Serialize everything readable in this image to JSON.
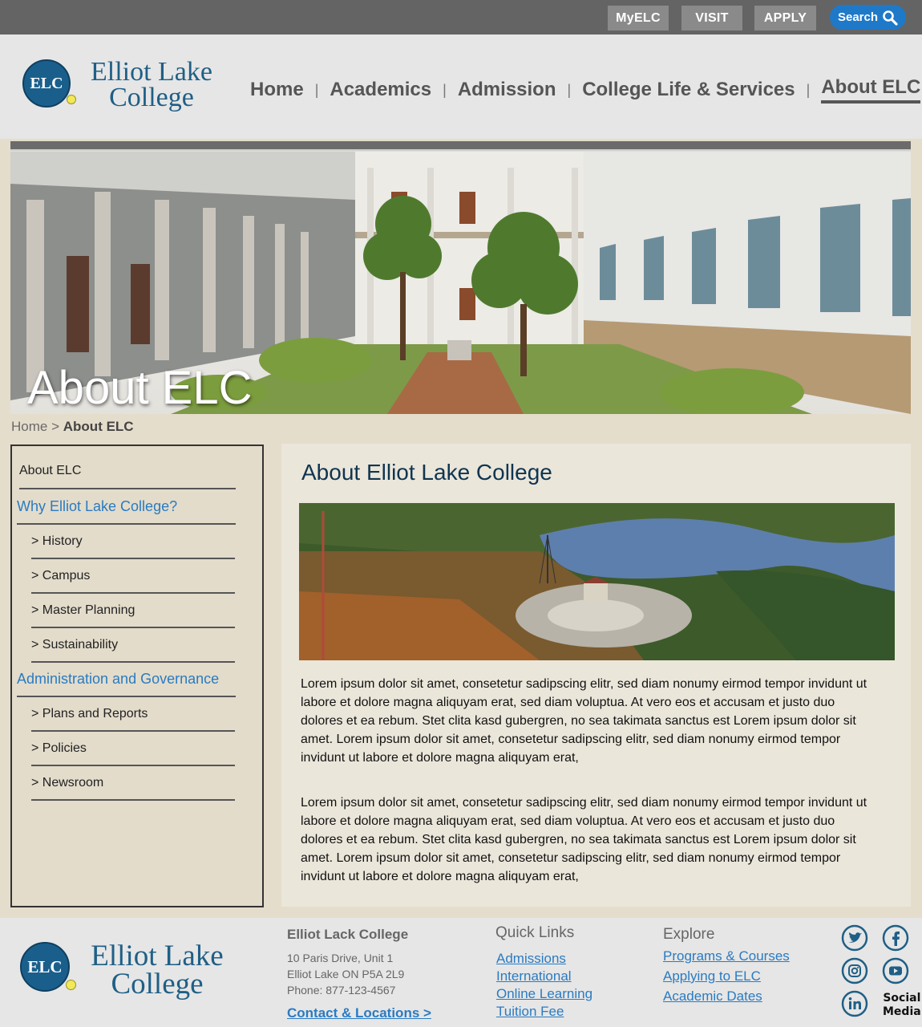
{
  "topbar": {
    "myelc": "MyELC",
    "visit": "VISIT",
    "apply": "APPLY",
    "search": "Search"
  },
  "header": {
    "logo_initials": "ELC",
    "logo_line1": "Elliot Lake",
    "logo_line2": "College",
    "nav": [
      "Home",
      "Academics",
      "Admission",
      "College Life & Services",
      "About ELC"
    ],
    "nav_separator": "|"
  },
  "hero": {
    "title": "About ELC"
  },
  "breadcrumb": {
    "home": "Home",
    "separator": ">",
    "current": "About ELC"
  },
  "sidebar": {
    "items": [
      {
        "label": "About ELC"
      },
      {
        "label": "Why Elliot Lake College?"
      },
      {
        "label": "> History"
      },
      {
        "label": "> Campus"
      },
      {
        "label": "> Master Planning"
      },
      {
        "label": "> Sustainability"
      },
      {
        "label": "Administration and Governance"
      },
      {
        "label": "> Plans and Reports"
      },
      {
        "label": "> Policies"
      },
      {
        "label": "> Newsroom"
      }
    ]
  },
  "main": {
    "heading": "About Elliot Lake College",
    "paragraphs": [
      "Lorem ipsum dolor sit amet, consetetur sadipscing elitr, sed diam nonumy eirmod tempor invidunt ut labore et dolore magna aliquyam erat, sed diam voluptua. At vero eos et accusam et justo duo dolores et ea rebum. Stet clita kasd gubergren, no sea takimata sanctus est Lorem ipsum dolor sit amet. Lorem ipsum dolor sit amet, consetetur sadipscing elitr, sed diam nonumy eirmod tempor invidunt ut labore et dolore magna aliquyam erat,",
      "Lorem ipsum dolor sit amet, consetetur sadipscing elitr, sed diam nonumy eirmod tempor invidunt ut labore et dolore magna aliquyam erat, sed diam voluptua. At vero eos et accusam et justo duo dolores et ea rebum. Stet clita kasd gubergren, no sea takimata sanctus est Lorem ipsum dolor sit amet. Lorem ipsum dolor sit amet, consetetur sadipscing elitr, sed diam nonumy eirmod tempor invidunt ut labore et dolore magna aliquyam erat,"
    ]
  },
  "footer": {
    "college_name": "Elliot Lack College",
    "address_line1": "10 Paris Drive, Unit 1",
    "address_line2": "Elliot Lake ON P5A 2L9",
    "phone": "Phone: 877-123-4567",
    "contact_link": "Contact & Locations >",
    "quick_links_title": "Quick Links",
    "quick_links": [
      "Admissions",
      "International",
      "Online Learning",
      "Tuition Fee"
    ],
    "explore_title": "Explore",
    "explore_links": [
      "Programs & Courses",
      "Applying to ELC",
      "Academic Dates"
    ],
    "social_label_line1": "Social",
    "social_label_line2": "Media",
    "social_icons": [
      "twitter-icon",
      "facebook-icon",
      "instagram-icon",
      "youtube-icon",
      "linkedin-icon"
    ]
  },
  "colors": {
    "topbar": "#646464",
    "header": "#e6e6e6",
    "page_bg": "#e5ddcb",
    "link_blue": "#2a7bc2",
    "logo_blue": "#1f5f86",
    "search_blue": "#1e79c9"
  }
}
